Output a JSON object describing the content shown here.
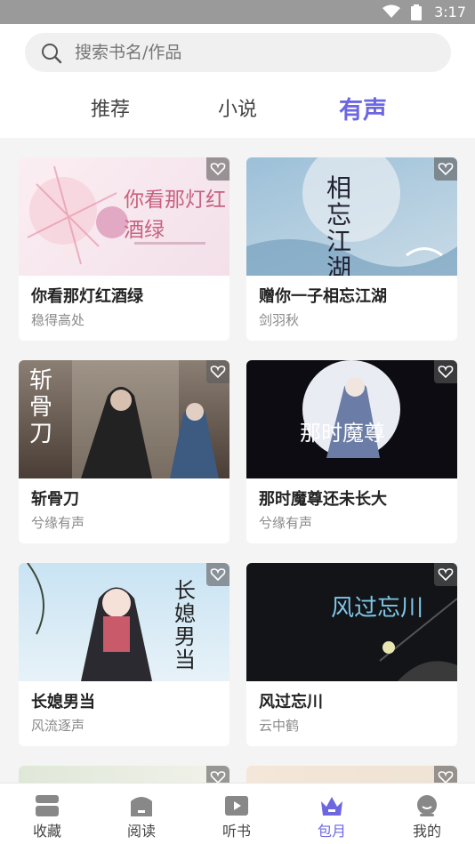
{
  "status_bar": {
    "time": "3:17"
  },
  "search": {
    "placeholder": "搜索书名/作品"
  },
  "tabs": [
    {
      "label": "推荐"
    },
    {
      "label": "小说"
    },
    {
      "label": "有声"
    }
  ],
  "books": [
    {
      "title": "你看那灯红酒绿",
      "author": "稳得高处",
      "cover_text": "你看那灯红酒绿"
    },
    {
      "title": "赠你一子相忘江湖",
      "author": "剑羽秋",
      "cover_text": "相忘江湖"
    },
    {
      "title": "斩骨刀",
      "author": "兮缘有声",
      "cover_text": "斩骨刀"
    },
    {
      "title": "那时魔尊还未长大",
      "author": "兮缘有声",
      "cover_text": "那时魔尊"
    },
    {
      "title": "长媳男当",
      "author": "风流逐声",
      "cover_text": "长媳男当"
    },
    {
      "title": "风过忘川",
      "author": "云中鹤",
      "cover_text": "风过忘川"
    }
  ],
  "bottom_nav": [
    {
      "label": "收藏",
      "icon": "bookshelf-icon"
    },
    {
      "label": "阅读",
      "icon": "book-icon"
    },
    {
      "label": "听书",
      "icon": "play-icon"
    },
    {
      "label": "包月",
      "icon": "crown-icon",
      "active": true
    },
    {
      "label": "我的",
      "icon": "user-icon"
    }
  ],
  "colors": {
    "accent": "#6c67e0",
    "status_bar": "#9a9a9a"
  }
}
